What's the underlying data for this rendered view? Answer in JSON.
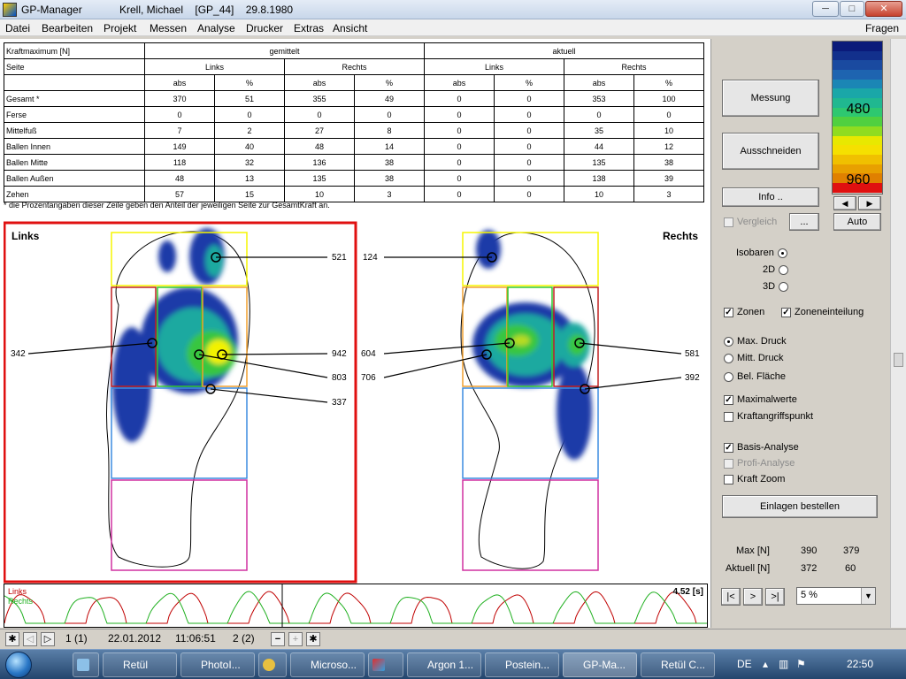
{
  "window": {
    "app_title": "GP-Manager",
    "patient_info": "Krell, Michael    [GP_44]    29.8.1980",
    "minimize": "─",
    "maximize": "□",
    "close": "✕"
  },
  "menu": {
    "items": [
      "Datei",
      "Bearbeiten",
      "Projekt",
      "Messen",
      "Analyse",
      "Drucker",
      "Extras",
      "Ansicht"
    ],
    "help": "Fragen"
  },
  "table": {
    "header_row1": [
      "Kraftmaximum [N]",
      "gemittelt",
      "aktuell"
    ],
    "header_row2": [
      "Seite",
      "Links",
      "Rechts",
      "Links",
      "Rechts"
    ],
    "header_row3": [
      "",
      "abs",
      "%",
      "abs",
      "%",
      "abs",
      "%",
      "abs",
      "%"
    ],
    "rows": [
      [
        "Gesamt *",
        "370",
        "51",
        "355",
        "49",
        "0",
        "0",
        "353",
        "100"
      ],
      [
        "Ferse",
        "0",
        "0",
        "0",
        "0",
        "0",
        "0",
        "0",
        "0"
      ],
      [
        "Mittelfuß",
        "7",
        "2",
        "27",
        "8",
        "0",
        "0",
        "35",
        "10"
      ],
      [
        "Ballen Innen",
        "149",
        "40",
        "48",
        "14",
        "0",
        "0",
        "44",
        "12"
      ],
      [
        "Ballen Mitte",
        "118",
        "32",
        "136",
        "38",
        "0",
        "0",
        "135",
        "38"
      ],
      [
        "Ballen Außen",
        "48",
        "13",
        "135",
        "38",
        "0",
        "0",
        "138",
        "39"
      ],
      [
        "Zehen",
        "57",
        "15",
        "10",
        "3",
        "0",
        "0",
        "10",
        "3"
      ]
    ],
    "footnote": "* die Prozentangaben dieser Zeile geben den Anteil der jeweiligen Seite zur GesamtKraft an."
  },
  "feet": {
    "left_label": "Links",
    "right_label": "Rechts",
    "left_values": [
      "521",
      "342",
      "942",
      "803",
      "337"
    ],
    "right_values": [
      "124",
      "604",
      "706",
      "581",
      "392"
    ]
  },
  "strip": {
    "legend_left": "Links",
    "legend_right": "Rechts",
    "time": "4.52 [s]"
  },
  "controls": {
    "messung": "Messung",
    "ausschneiden": "Ausschneiden",
    "info": "Info ..",
    "vergleich": "Vergleich",
    "ellipsis": "...",
    "auto": "Auto",
    "scale_left": "◀",
    "scale_right": "▶",
    "scale_values": [
      "480",
      "960"
    ],
    "isobaren": "Isobaren",
    "d2": "2D",
    "d3": "3D",
    "zonen": "Zonen",
    "zoneneinteilung": "Zoneneinteilung",
    "max_druck": "Max. Druck",
    "mitt_druck": "Mitt. Druck",
    "bel_flaeche": "Bel. Fläche",
    "maximalwerte": "Maximalwerte",
    "kraftangriffspunkt": "Kraftangriffspunkt",
    "basis_analyse": "Basis-Analyse",
    "profi_analyse": "Profi-Analyse",
    "kraft_zoom": "Kraft Zoom",
    "einlagen": "Einlagen bestellen",
    "max_label": "Max [N]",
    "max_left": "390",
    "max_right": "379",
    "aktuell_label": "Aktuell [N]",
    "aktuell_left": "372",
    "aktuell_right": "60",
    "nav_first": "|<",
    "nav_next": ">",
    "nav_last": ">|",
    "percent_select": "5 %",
    "select_arrow": "▼"
  },
  "statusbar": {
    "page": "1 (1)",
    "date": "22.01.2012",
    "time": "11:06:51",
    "count": "2 (2)",
    "minus": "−",
    "plus": "+"
  },
  "taskbar": {
    "items": [
      "Retül",
      "PhotoI...",
      "",
      "Microso...",
      "",
      "Argon 1...",
      "Postein...",
      "GP-Ma...",
      "Retül C..."
    ],
    "lang": "DE",
    "clock": "22:50"
  },
  "colors": {
    "accent_red": "#e01010",
    "zone_yellow": "#f5f500",
    "zone_green": "#30c830",
    "zone_orange": "#f0a030",
    "zone_red": "#c02020",
    "zone_blue": "#3c8ce0",
    "zone_magenta": "#d030a0"
  }
}
